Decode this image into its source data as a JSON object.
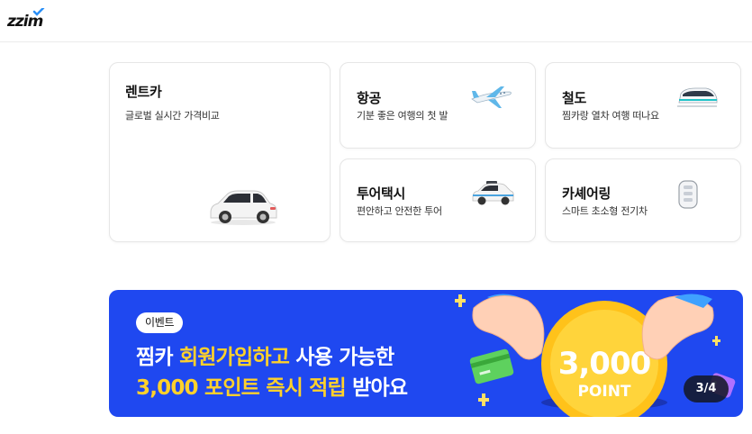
{
  "header": {
    "logo_text": "zzim",
    "logo_color": "#111111",
    "logo_accent": "#2a8ff7"
  },
  "services": [
    {
      "title": "렌트카",
      "subtitle": "글로벌 실시간 가격비교",
      "icon": "white-car-icon"
    },
    {
      "title": "항공",
      "subtitle": "기분 좋은 여행의 첫 발",
      "icon": "airplane-icon"
    },
    {
      "title": "철도",
      "subtitle": "찜카랑 열차 여행 떠나요",
      "icon": "train-icon"
    },
    {
      "title": "투어택시",
      "subtitle": "편안하고 안전한 투어",
      "icon": "taxi-icon"
    },
    {
      "title": "카셰어링",
      "subtitle": "스마트 초소형 전기차",
      "icon": "car-key-icon"
    }
  ],
  "banner": {
    "badge": "이벤트",
    "line1": {
      "a": "찜카 ",
      "b": "회원가입하고",
      "c": " 사용 가능한"
    },
    "line2": {
      "a": "3,000 포인트 즉시 적립",
      "b": " 받아요"
    },
    "coin_amount": "3,000",
    "coin_unit": "POINT",
    "pager": "3/4",
    "bg_color": "#1f48f0",
    "highlight_color": "#ffd12b"
  }
}
